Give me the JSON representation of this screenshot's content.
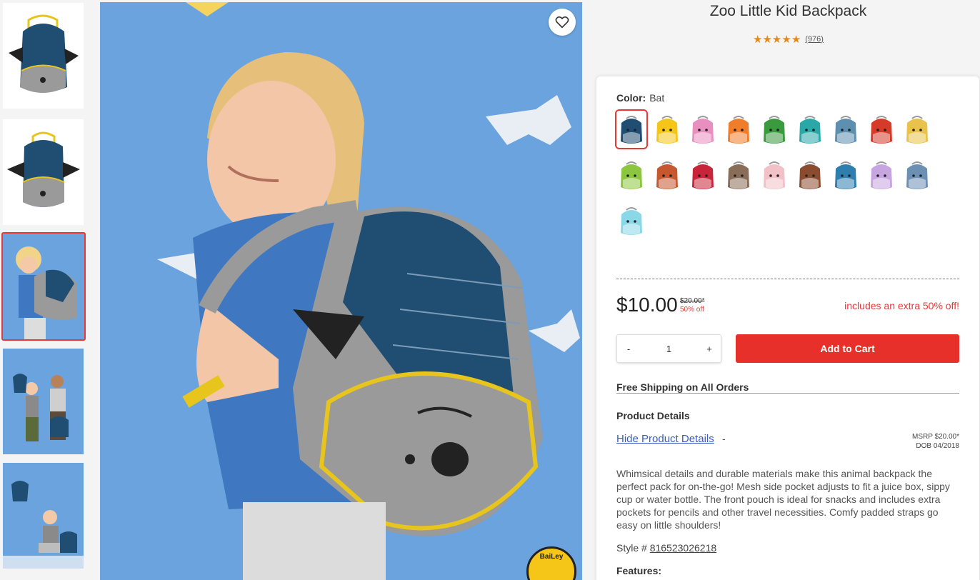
{
  "product": {
    "title": "Zoo Little Kid Backpack",
    "rating_stars": "★★★★★",
    "review_count": "(976)"
  },
  "color": {
    "label": "Color:",
    "selected": "Bat",
    "swatch_colors": [
      "#1f4e72",
      "#f5c518",
      "#e98fc0",
      "#f07d2b",
      "#3a9a3e",
      "#2aa8a8",
      "#5d8fb0",
      "#d63b2a",
      "#e8c24a",
      "#8cc63f",
      "#c7572e",
      "#c8253a",
      "#8a6d58",
      "#f2c1c7",
      "#8a4b2e",
      "#2e7fb0",
      "#c6a5e0",
      "#6c8fb4",
      "#8ad7e8"
    ]
  },
  "pricing": {
    "price": "$10.00",
    "old_price": "$20.00*",
    "discount": "50% off",
    "extra": "includes an extra 50% off!"
  },
  "cart": {
    "minus": "-",
    "quantity": "1",
    "plus": "+",
    "add_label": "Add to Cart"
  },
  "shipping": "Free Shipping on All Orders",
  "details": {
    "title": "Product Details",
    "hide_link": "Hide Product Details",
    "hide_dash": "-",
    "msrp": "MSRP $20.00*",
    "dob": "DOB 04/2018",
    "description": "Whimsical details and durable materials make this animal backpack the perfect pack for on-the-go! Mesh side pocket adjusts to fit a juice box, sippy cup or water bottle. The front pouch is ideal for snacks and includes extra pockets for pencils and other travel necessities. Comfy padded straps go easy on little shoulders!",
    "style_label": "Style # ",
    "style_number": "816523026218",
    "features": "Features:"
  },
  "badge": {
    "text": "BaiLey"
  },
  "colors": {
    "accent_red": "#e8302a",
    "star_orange": "#e08a1e",
    "link_blue": "#3b5bbf",
    "photo_blue": "#6aa3dd"
  },
  "icons": {
    "favorite": "heart-outline-icon"
  }
}
